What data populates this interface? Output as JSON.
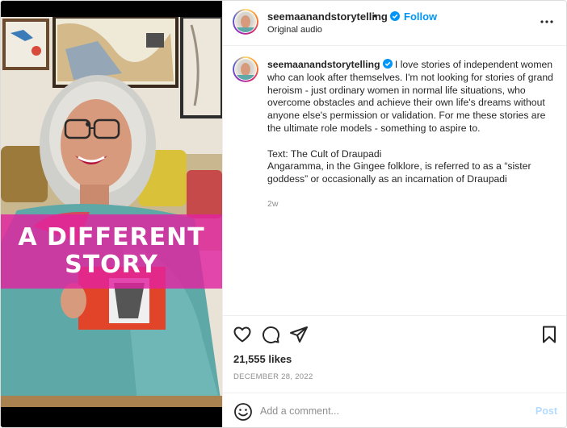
{
  "post": {
    "username": "seemaanandstorytelling",
    "follow_label": "Follow",
    "separator": "•",
    "audio": "Original audio",
    "more_icon": "more-horizontal-icon",
    "verified_icon": "verified-badge-icon"
  },
  "media": {
    "overlay_line1": "A DIFFERENT",
    "overlay_line2": "STORY",
    "overlay_color": "#e223a0"
  },
  "caption": {
    "username": "seemaanandstorytelling",
    "text1": "I love stories of independent women who can look after themselves. I'm not looking for stories of grand heroism - just ordinary women in normal life situations, who overcome obstacles and achieve their own life's dreams without anyone else's permission or validation. For me these stories are the ultimate role models - something to aspire to.",
    "text2": "Text: The Cult of Draupadi",
    "text3": "Angaramma, in the Gingee folklore, is referred to as a “sister goddess” or occasionally as an incarnation of Draupadi",
    "time_ago": "2w"
  },
  "actions": {
    "likes": "21,555 likes",
    "date": "DECEMBER 28, 2022",
    "icons": [
      "heart-icon",
      "comment-icon",
      "share-icon",
      "bookmark-icon"
    ]
  },
  "comment": {
    "placeholder": "Add a comment...",
    "post_label": "Post",
    "emoji_icon": "emoji-icon"
  },
  "colors": {
    "accent": "#0095f6",
    "post_disabled": "#b3dbff",
    "muted": "#8e8e8e"
  }
}
